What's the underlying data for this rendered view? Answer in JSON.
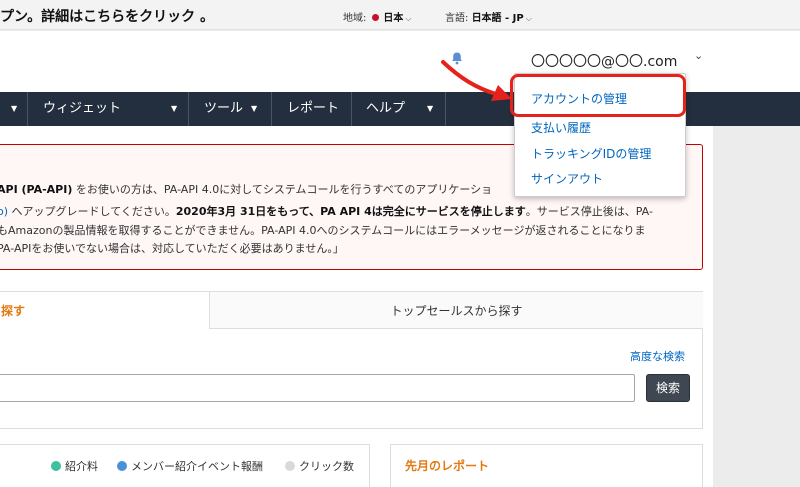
{
  "topbar": {
    "promo": "プン。詳細はこちらをクリック 。",
    "region_label": "地域:",
    "region_value": "日本",
    "language_label": "言語:",
    "language_value": "日本語 - JP"
  },
  "header": {
    "account_email": "〇〇〇〇〇@〇〇.com"
  },
  "nav": {
    "items": [
      {
        "label": "ウィジェット"
      },
      {
        "label": "ツール"
      },
      {
        "label": "レポート"
      },
      {
        "label": "ヘルプ"
      }
    ]
  },
  "account_menu": {
    "items": [
      {
        "label": "アカウントの管理"
      },
      {
        "label": "支払い履歴"
      },
      {
        "label": "トラッキングIDの管理"
      },
      {
        "label": "サインアウト"
      }
    ]
  },
  "alert": {
    "l1_a": "API (PA-API)",
    "l1_b": " をお使いの方は、PA-API 4.0に対してシステムコールを行うすべてのアプリケーショ",
    "l2_a": "o)",
    "l2_b": " へアップグレードしてください。",
    "l2_c": "2020年3月 31日をもって、PA API 4は完全にサービスを停止します",
    "l2_d": "。サービス停止後は、PA-",
    "l3": "もAmazonの製品情報を取得することができません。PA-API 4.0へのシステムコールにはエラーメッセージが返されることになりま",
    "l4": "PA-APIをお使いでない場合は、対応していただく必要はありません。」"
  },
  "search": {
    "tab_active": "探す",
    "tab_inactive": "トップセールスから探す",
    "advanced_link": "高度な検索",
    "input_value": "",
    "button": "検索"
  },
  "chart_legend": {
    "items": [
      {
        "label": "紹介料",
        "color": "#3dbfa0"
      },
      {
        "label": "メンバー紹介イベント報酬",
        "color": "#4a90d9"
      },
      {
        "label": "クリック数",
        "color": "#d9d9d9"
      }
    ]
  },
  "report": {
    "title": "先月のレポート"
  },
  "colors": {
    "nav_bg": "#232f3e",
    "accent_orange": "#e47911",
    "link_blue": "#0066c0",
    "alert_red": "#c40000",
    "highlight_red": "#e5231c"
  }
}
